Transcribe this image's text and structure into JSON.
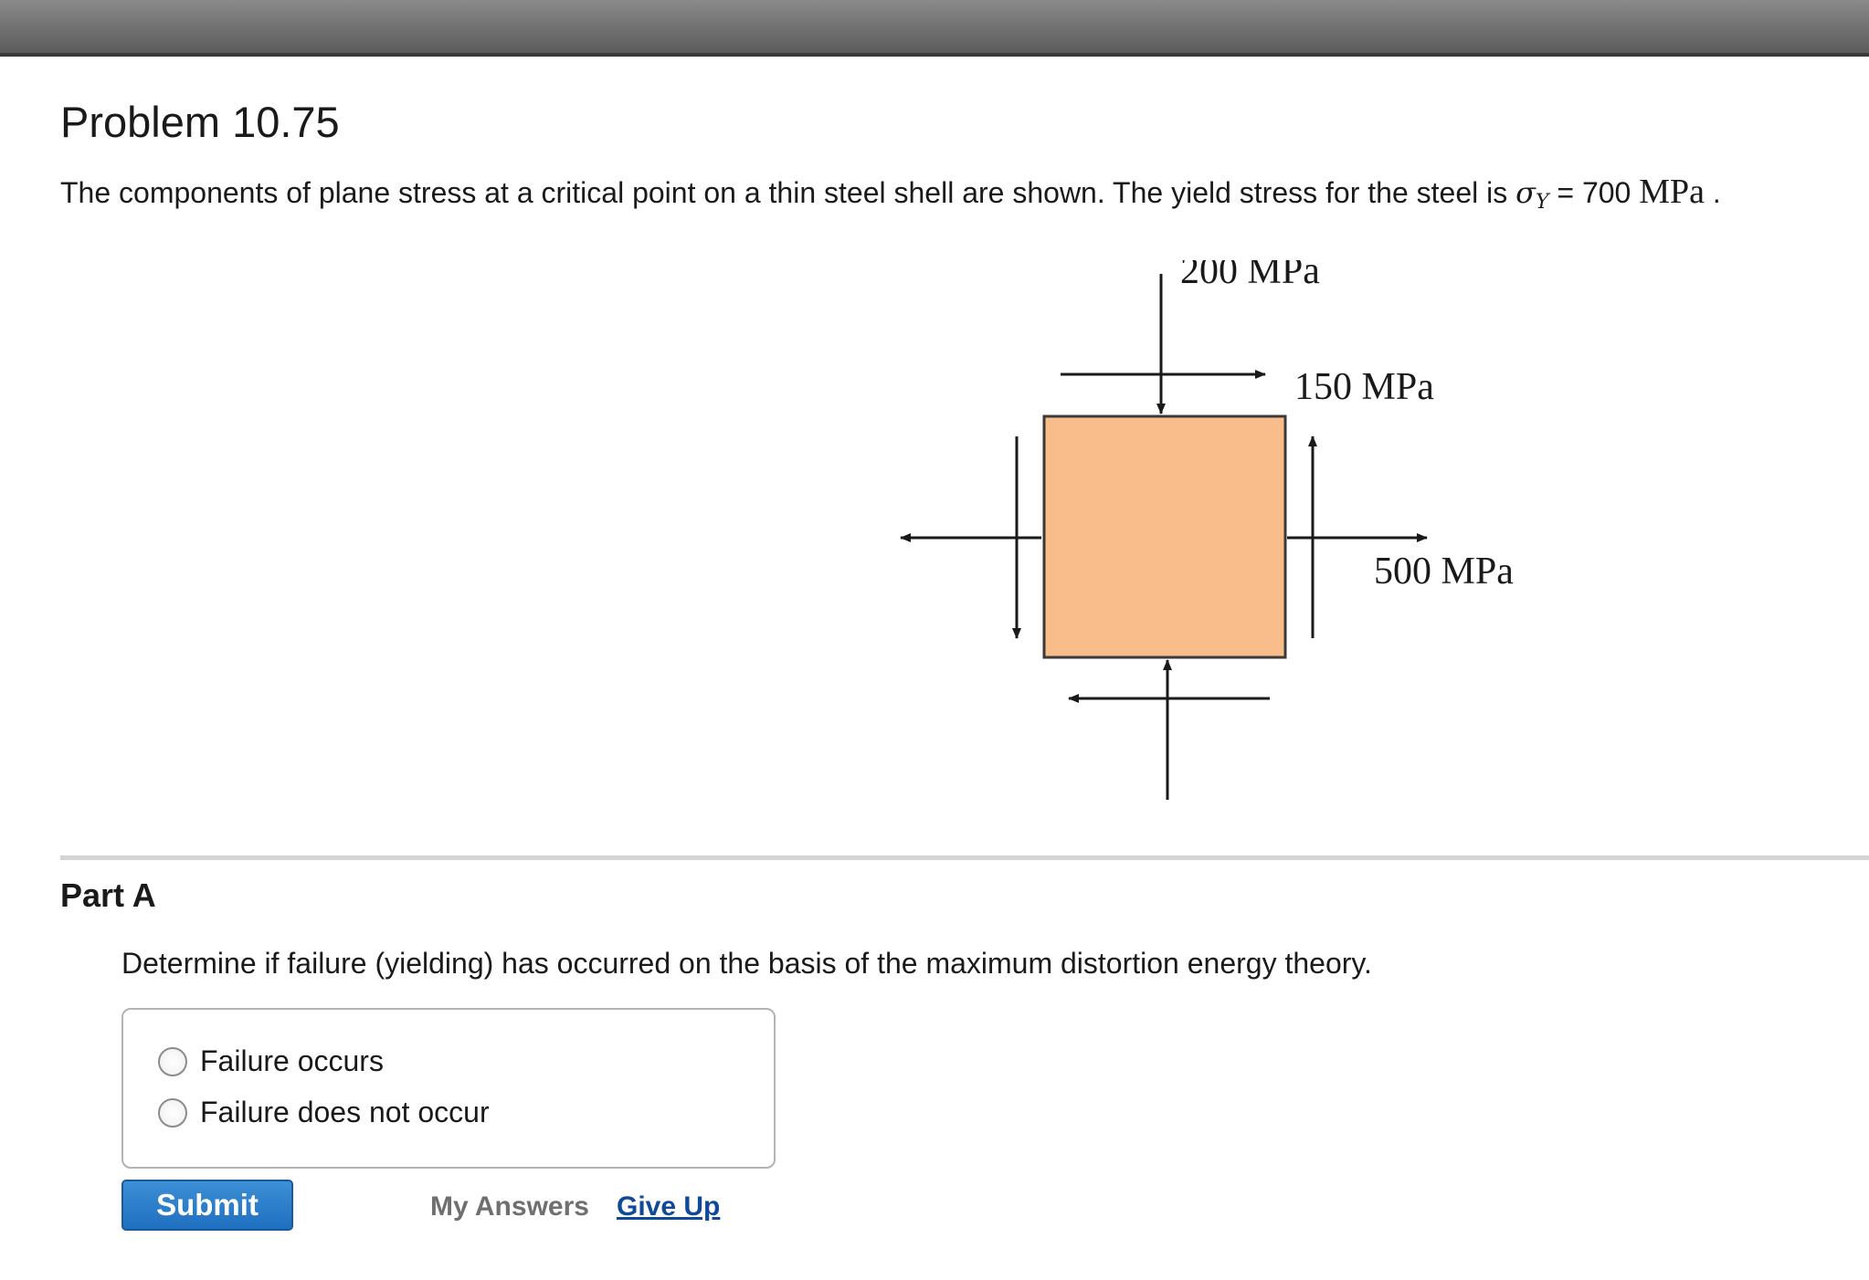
{
  "problem": {
    "title": "Problem 10.75",
    "statement_prefix": "The components of plane stress at a critical point on a thin steel shell are shown. The yield stress for the steel is ",
    "sigma": "σ",
    "sigma_sub": "Y",
    "equals_value": " = 700 ",
    "unit": "MPa",
    "period": " ."
  },
  "figure": {
    "label_top": "200 MPa",
    "label_shear": "150 MPa",
    "label_right": "500 MPa",
    "element_color": "#F9BC8B"
  },
  "part_a": {
    "title": "Part A",
    "question": "Determine if failure (yielding) has occurred on the basis of the maximum distortion energy theory.",
    "options": [
      {
        "label": "Failure occurs",
        "selected": false
      },
      {
        "label": "Failure does not occur",
        "selected": false
      }
    ],
    "submit_label": "Submit",
    "my_answers_label": "My Answers",
    "give_up_label": "Give Up"
  },
  "colors": {
    "submit_button": "#1f6fc0",
    "link": "#10489a"
  }
}
